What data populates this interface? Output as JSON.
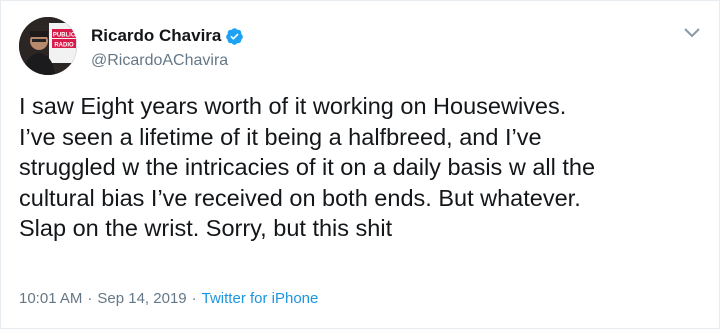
{
  "user": {
    "display_name": "Ricardo Chavira",
    "handle": "@RicardoAChavira",
    "verified": true,
    "avatar_text": [
      "PUBLIC",
      "RADIO"
    ]
  },
  "tweet": {
    "lines": [
      "I saw Eight years worth of it working on Housewives.",
      "I’ve seen a lifetime of it being a halfbreed, and I’ve",
      "struggled w the intricacies of it on a daily basis w all the",
      "cultural bias I’ve received on both ends. But whatever.",
      "Slap on the wrist. Sorry, but this shit"
    ]
  },
  "meta": {
    "time": "10:01 AM",
    "separator1": "·",
    "date": "Sep 14, 2019",
    "separator2": "·",
    "source": "Twitter for iPhone"
  },
  "icons": {
    "verified": "verified-badge-icon",
    "caret": "chevron-down-icon"
  },
  "colors": {
    "text": "#14171a",
    "secondary": "#657786",
    "link": "#1b95e0",
    "verified": "#1da1f2"
  }
}
